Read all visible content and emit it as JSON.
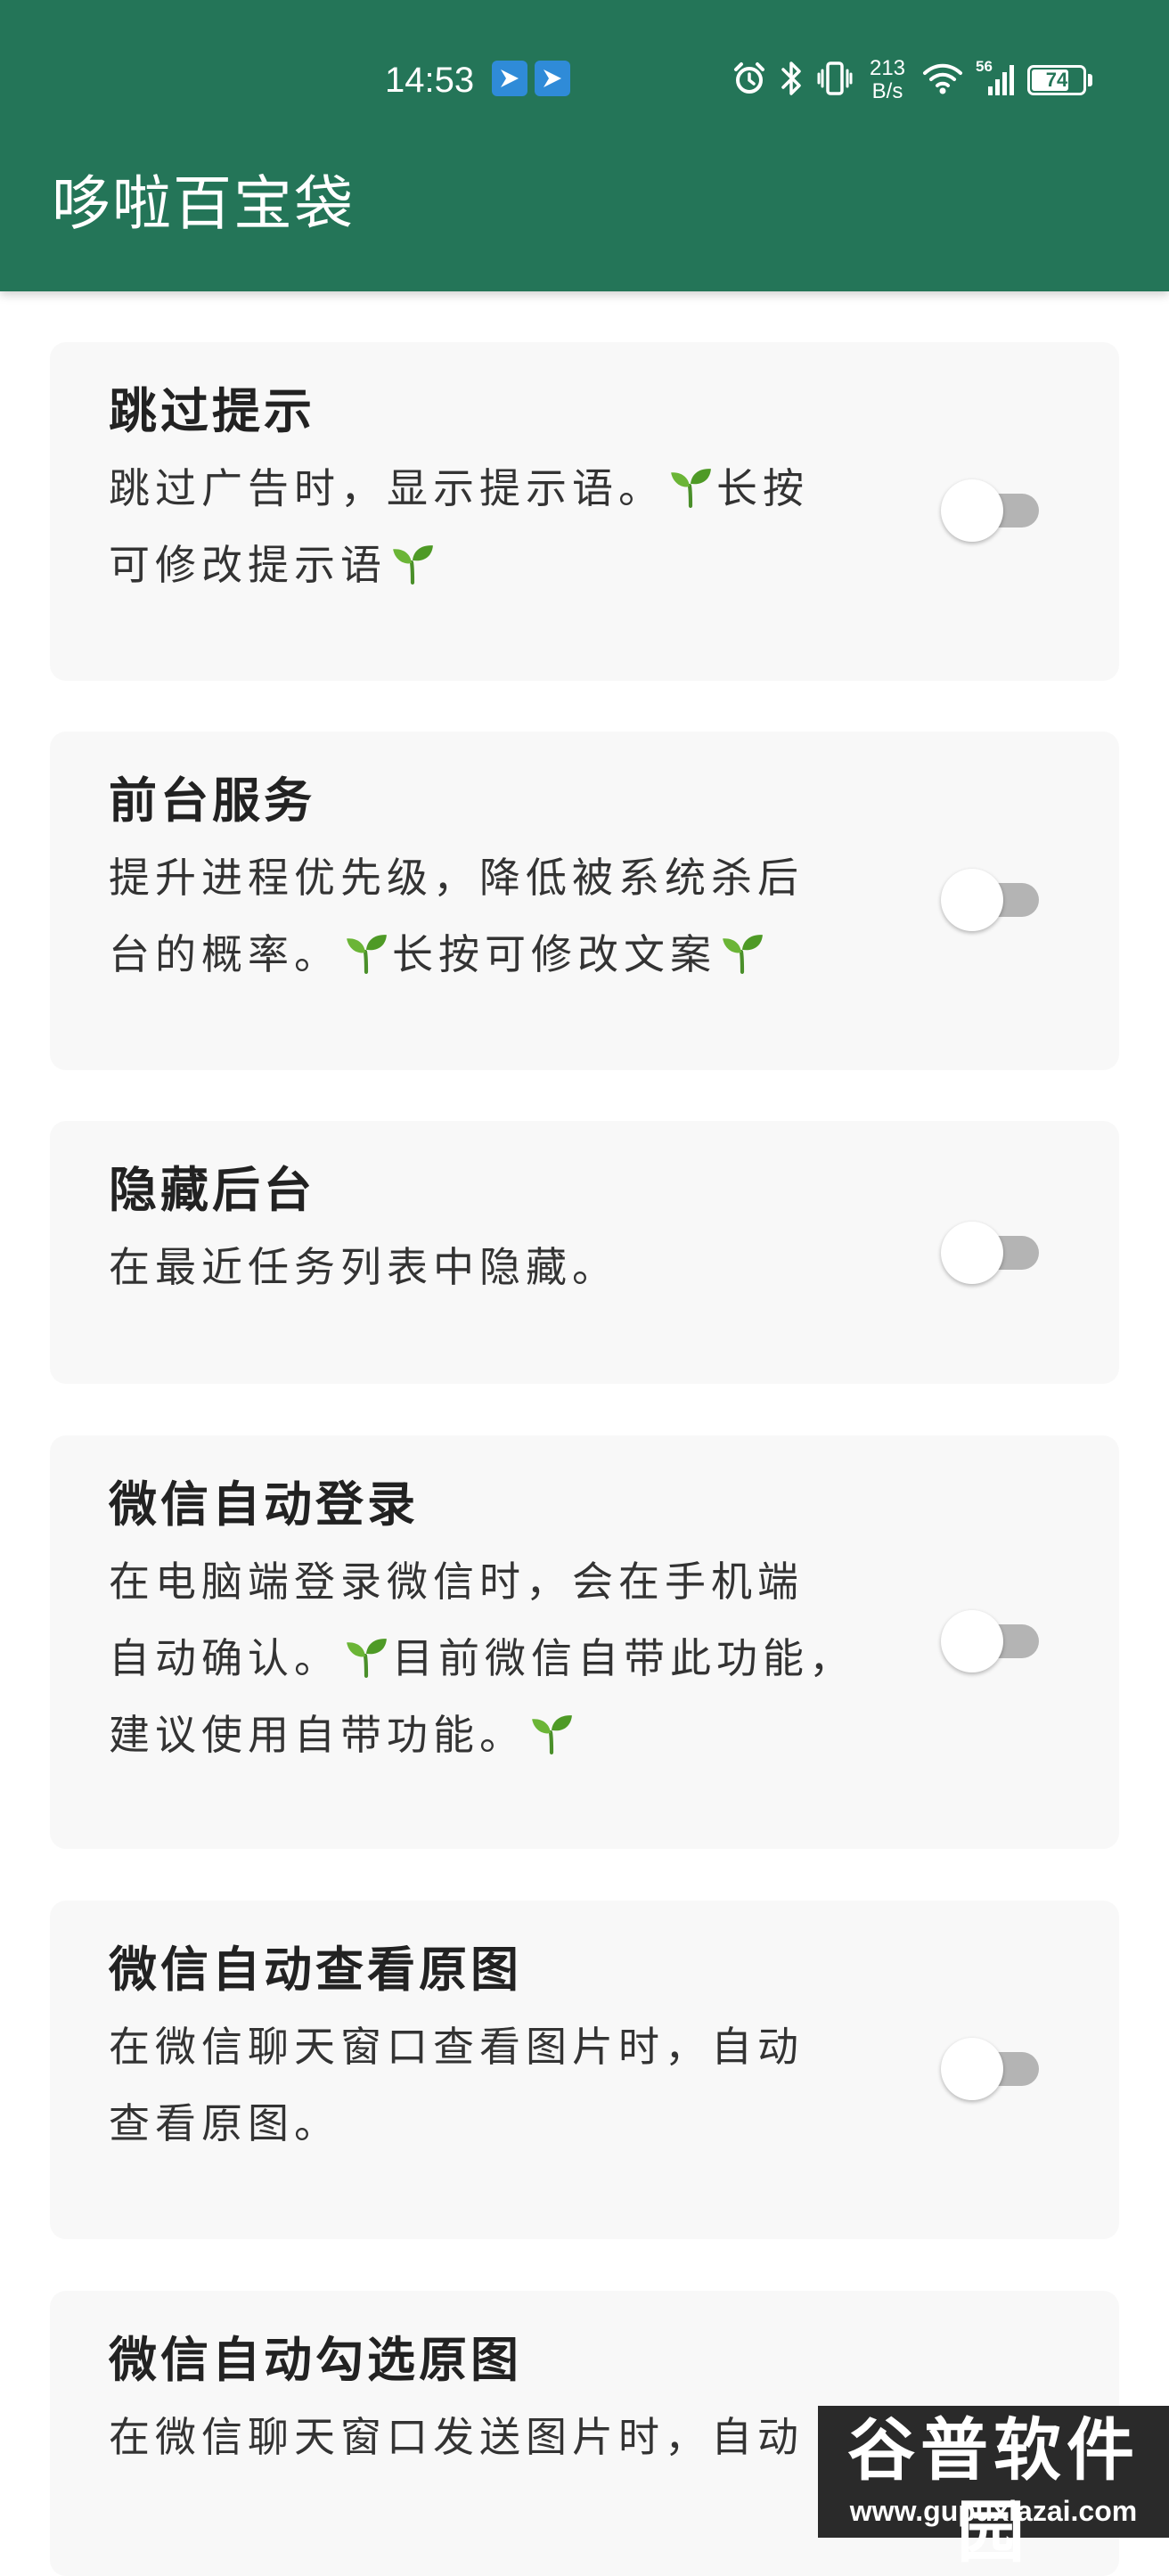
{
  "status_bar": {
    "time": "14:53",
    "net_speed_value": "213",
    "net_speed_unit": "B/s",
    "signal_type": "56",
    "battery_level": 74,
    "battery_text": "74"
  },
  "app_bar": {
    "title": "哆啦百宝袋",
    "color": "#247558"
  },
  "settings": [
    {
      "title": "跳过提示",
      "desc_lines": [
        "跳过广告时，显示提示语。",
        "长按",
        "可修改提示语"
      ],
      "enabled": false
    },
    {
      "title": "前台服务",
      "desc_lines": [
        "提升进程优先级，降低被系统杀后",
        "台的概率。",
        "长按可修改文案"
      ],
      "enabled": false
    },
    {
      "title": "隐藏后台",
      "desc_lines": [
        "在最近任务列表中隐藏。"
      ],
      "enabled": false
    },
    {
      "title": "微信自动登录",
      "desc_lines": [
        "在电脑端登录微信时，会在手机端",
        "自动确认。",
        "目前微信自带此功能，",
        "建议使用自带功能。"
      ],
      "enabled": false
    },
    {
      "title": "微信自动查看原图",
      "desc_lines": [
        "在微信聊天窗口查看图片时，自动",
        "查看原图。"
      ],
      "enabled": false
    },
    {
      "title": "微信自动勾选原图",
      "desc_lines": [
        "在微信聊天窗口发送图片时，自动"
      ],
      "enabled": false
    }
  ],
  "watermark": {
    "title": "谷普软件园",
    "url": "www.gupuxiazai.com"
  },
  "icons": {
    "sprout": "sprout-icon",
    "alarm": "alarm-icon",
    "bluetooth": "bluetooth-icon",
    "vibrate": "vibrate-icon",
    "wifi": "wifi-icon",
    "signal": "signal-icon",
    "battery": "battery-icon"
  }
}
